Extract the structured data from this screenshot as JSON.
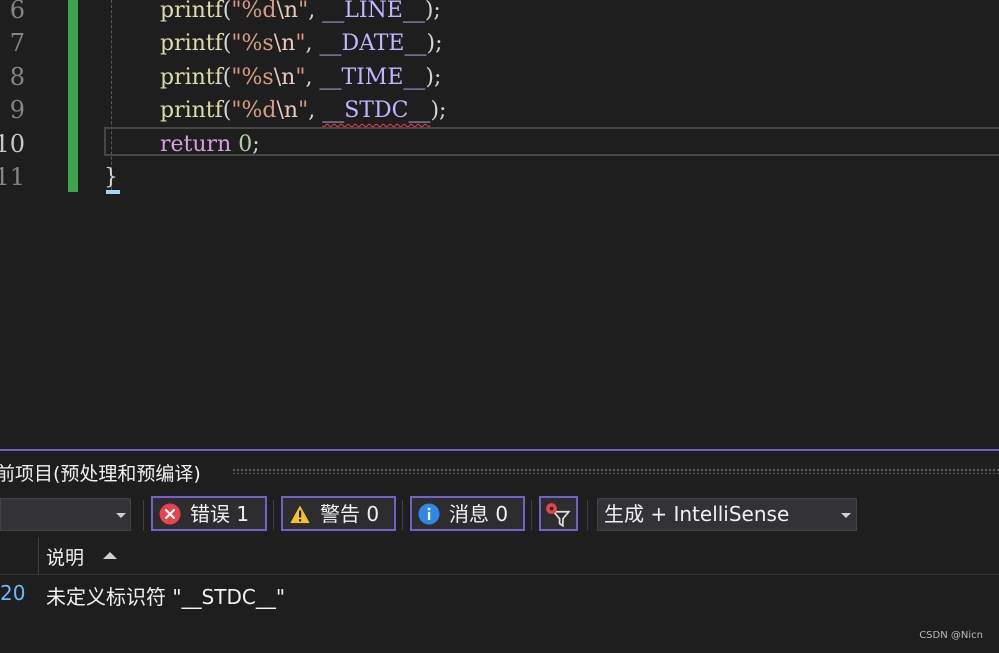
{
  "editor": {
    "lines": [
      {
        "num": "6",
        "parts": [
          [
            "fn",
            "printf"
          ],
          [
            "pn",
            "("
          ],
          [
            "st",
            "\"%d"
          ],
          [
            "esc",
            "\\n"
          ],
          [
            "st",
            "\""
          ],
          [
            "pn",
            ", "
          ],
          [
            "mac",
            "__LINE__"
          ],
          [
            "pn",
            ");"
          ]
        ]
      },
      {
        "num": "7",
        "parts": [
          [
            "fn",
            "printf"
          ],
          [
            "pn",
            "("
          ],
          [
            "st",
            "\"%s"
          ],
          [
            "esc",
            "\\n"
          ],
          [
            "st",
            "\""
          ],
          [
            "pn",
            ", "
          ],
          [
            "mac",
            "__DATE__"
          ],
          [
            "pn",
            ");"
          ]
        ]
      },
      {
        "num": "8",
        "parts": [
          [
            "fn",
            "printf"
          ],
          [
            "pn",
            "("
          ],
          [
            "st",
            "\"%s"
          ],
          [
            "esc",
            "\\n"
          ],
          [
            "st",
            "\""
          ],
          [
            "pn",
            ", "
          ],
          [
            "mac",
            "__TIME__"
          ],
          [
            "pn",
            ");"
          ]
        ]
      },
      {
        "num": "9",
        "parts": [
          [
            "fn",
            "printf"
          ],
          [
            "pn",
            "("
          ],
          [
            "st",
            "\"%d"
          ],
          [
            "esc",
            "\\n"
          ],
          [
            "st",
            "\""
          ],
          [
            "pn",
            ", "
          ],
          [
            "mac squig",
            "__STDC__"
          ],
          [
            "pn",
            ");"
          ]
        ]
      },
      {
        "num": "10",
        "parts": [
          [
            "kw",
            "return"
          ],
          [
            "pn",
            " "
          ],
          [
            "num",
            "0"
          ],
          [
            "pn",
            ";"
          ]
        ]
      },
      {
        "num": "11",
        "parts": [
          [
            "pn",
            "}"
          ]
        ]
      }
    ],
    "active_line": "10"
  },
  "panel": {
    "title": "前项目(预处理和预编译)",
    "scope_value": "",
    "errors_label": "错误 1",
    "warnings_label": "警告 0",
    "messages_label": "消息 0",
    "source_value": "生成 + IntelliSense",
    "columns": {
      "code": "",
      "description": "说明"
    },
    "rows": [
      {
        "code": "20",
        "description": "未定义标识符 \"__STDC__\""
      }
    ]
  },
  "watermark": "CSDN @Nicn",
  "colors": {
    "accent": "#7162c9",
    "error": "#e6434c",
    "warning": "#f2c12e",
    "info": "#2f88e4",
    "gutter_changed": "#3fa34d"
  }
}
